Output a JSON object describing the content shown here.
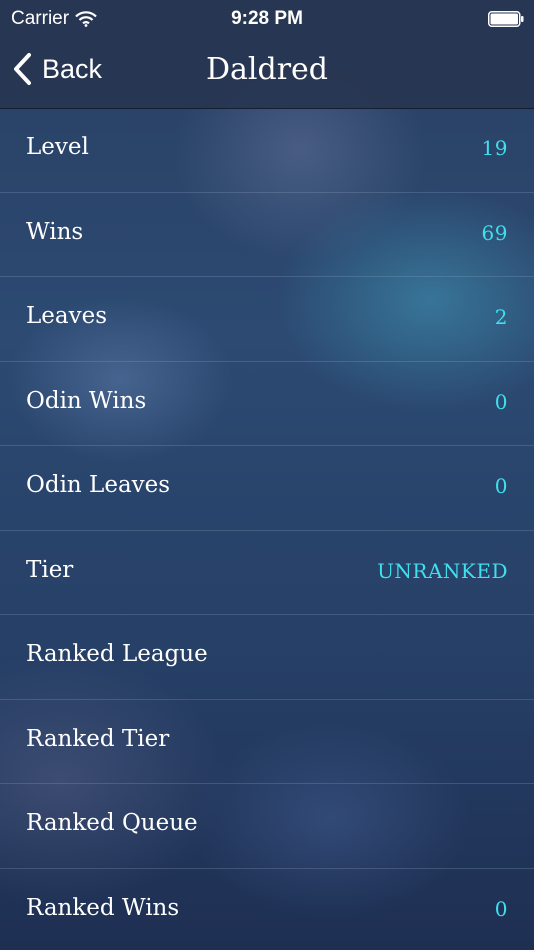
{
  "status_bar": {
    "carrier": "Carrier",
    "time": "9:28 PM",
    "icons": [
      "wifi-icon",
      "battery-icon"
    ]
  },
  "nav": {
    "back_label": "Back",
    "title": "Daldred",
    "back_icon": "chevron-left-icon"
  },
  "colors": {
    "value_accent": "#3fe0ee",
    "bar_background": "#273550"
  },
  "rows": [
    {
      "label": "Level",
      "value": "19"
    },
    {
      "label": "Wins",
      "value": "69"
    },
    {
      "label": "Leaves",
      "value": "2"
    },
    {
      "label": "Odin Wins",
      "value": "0"
    },
    {
      "label": "Odin Leaves",
      "value": "0"
    },
    {
      "label": "Tier",
      "value": "UNRANKED"
    },
    {
      "label": "Ranked League",
      "value": ""
    },
    {
      "label": "Ranked Tier",
      "value": ""
    },
    {
      "label": "Ranked Queue",
      "value": ""
    },
    {
      "label": "Ranked Wins",
      "value": "0"
    }
  ]
}
